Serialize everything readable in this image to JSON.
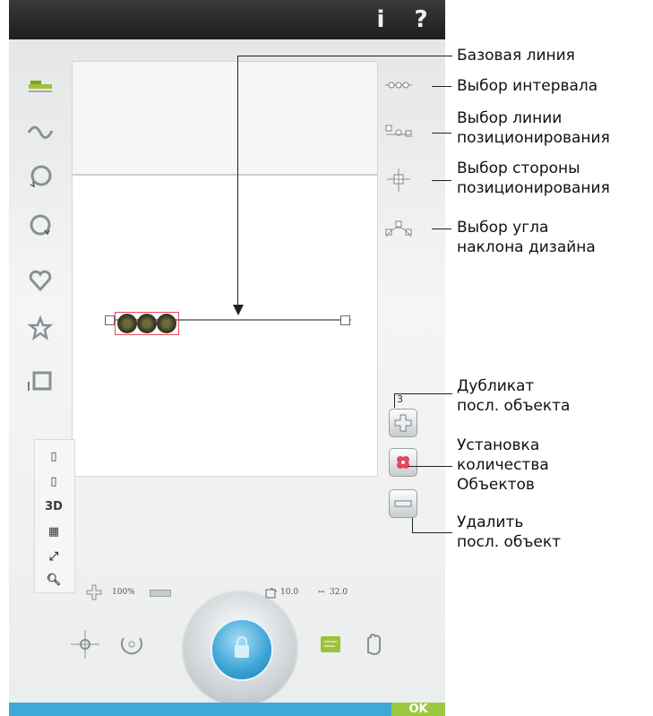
{
  "topbar": {
    "info_label": "i",
    "help_label": "?"
  },
  "left_tools": [
    "baseline-tool-icon",
    "wave-curve-icon",
    "circle-cw-icon",
    "circle-ccw-icon",
    "heart-icon",
    "star-icon",
    "square-icon"
  ],
  "view_tools": {
    "three_d_label": "3D"
  },
  "info_strip": {
    "zoom": "100%",
    "width_value": "10.0",
    "spacing_value": "32.0"
  },
  "duplicate": {
    "count": "3"
  },
  "annotations": {
    "baseline": "Базовая линия",
    "spacing": "Выбор интервала",
    "positioning_line": [
      "Выбор линии",
      "позиционирования"
    ],
    "positioning_side": [
      "Выбор стороны",
      "позиционирования"
    ],
    "tilt_angle": [
      "Выбор угла",
      "наклона дизайна"
    ],
    "duplicate_last": [
      "Дубликат",
      "посл. объекта"
    ],
    "set_count": [
      "Установка",
      "количества",
      "Объектов"
    ],
    "delete_last": [
      "Удалить",
      "посл. объект"
    ]
  },
  "bottom": {
    "ok_label": "OK"
  },
  "colors": {
    "ok_green": "#9cc840",
    "bottom_bar_blue": "#3ea9d7",
    "selection_red": "#e4495a"
  }
}
